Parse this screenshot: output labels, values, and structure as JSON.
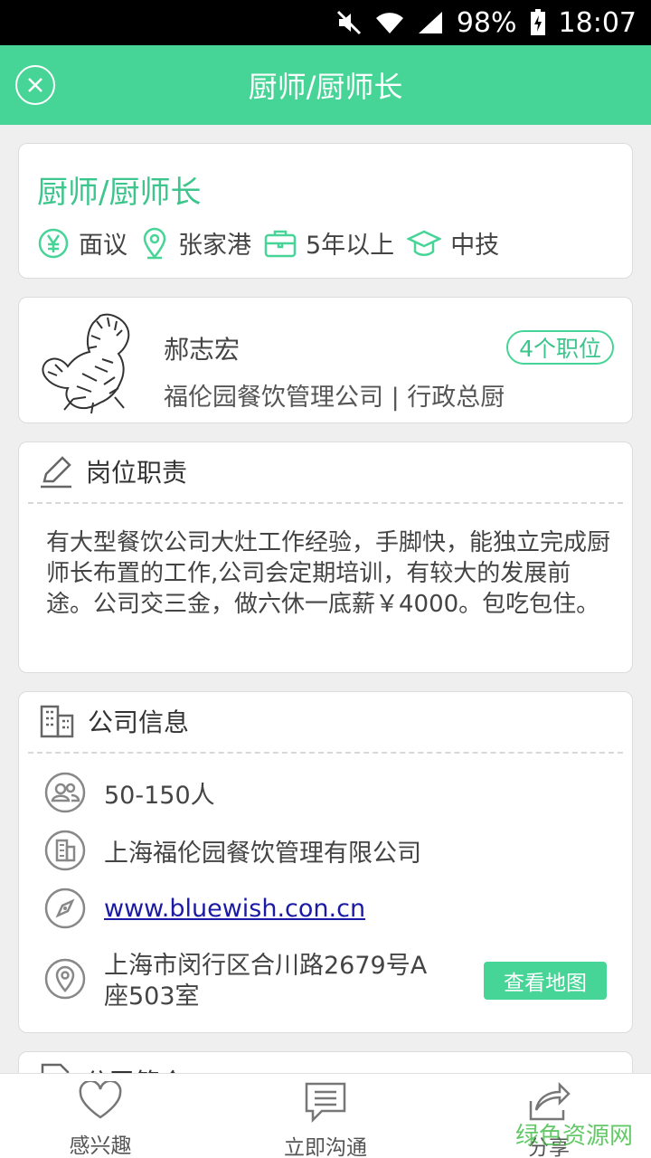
{
  "status_bar": {
    "battery": "98%",
    "time": "18:07"
  },
  "header": {
    "title": "厨师/厨师长"
  },
  "job": {
    "title": "厨师/厨师长",
    "salary": "面议",
    "location": "张家港",
    "experience": "5年以上",
    "education": "中技"
  },
  "recruiter": {
    "name": "郝志宏",
    "company_line": "福伦园餐饮管理公司 | 行政总厨",
    "positions_badge": "4个职位"
  },
  "duties": {
    "heading": "岗位职责",
    "text": "有大型餐饮公司大灶工作经验，手脚快，能独立完成厨师长布置的工作,公司会定期培训，有较大的发展前途。公司交三金，做六休一底薪￥4000。包吃包住。"
  },
  "company_info": {
    "heading": "公司信息",
    "size": "50-150人",
    "name": "上海福伦园餐饮管理有限公司",
    "website": "www.bluewish.con.cn",
    "address_line1": "上海市闵行区合川路2679号A",
    "address_line2": "座503室",
    "map_button": "查看地图"
  },
  "intro": {
    "heading": "公司简介"
  },
  "tabs": {
    "interested": "感兴趣",
    "chat": "立即沟通",
    "share": "分享"
  },
  "watermark": "绿色资源网",
  "colors": {
    "accent": "#47d497",
    "link": "#1a1aa6"
  }
}
